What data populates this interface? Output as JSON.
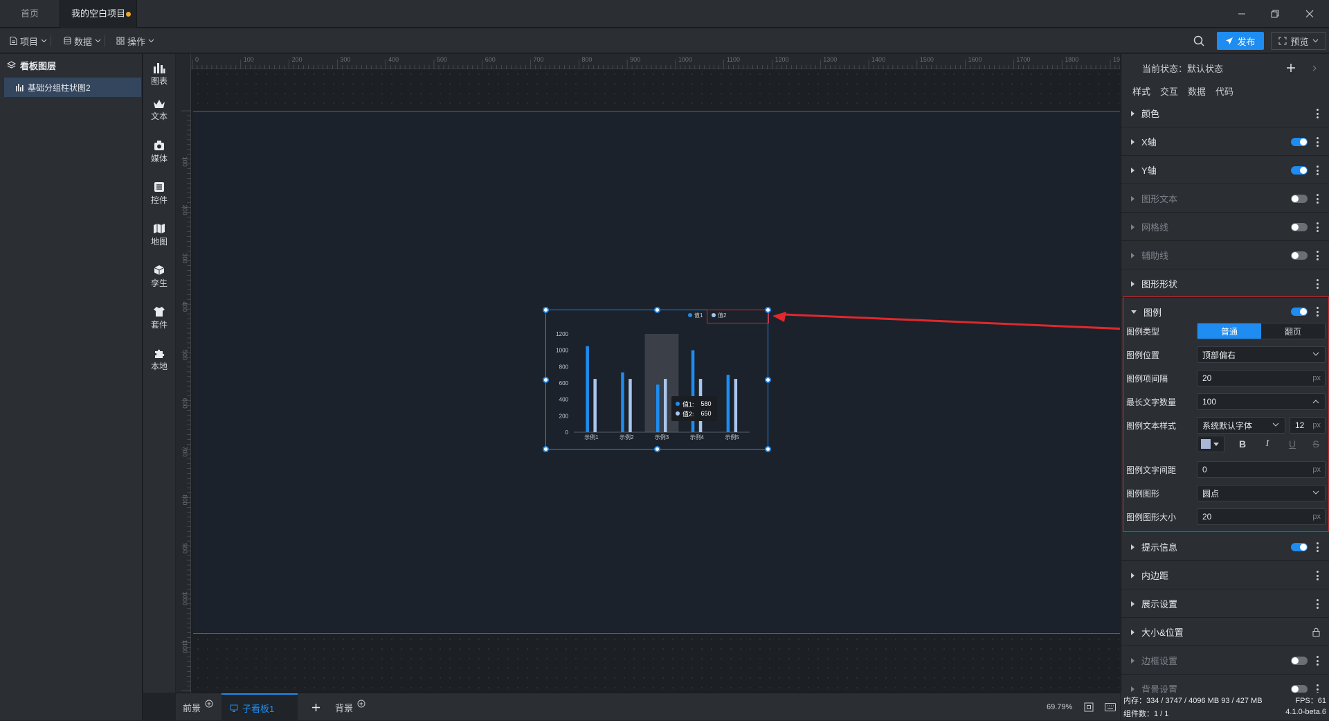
{
  "titlebar": {
    "tabs": [
      {
        "label": "首页"
      },
      {
        "label": "我的空白项目"
      }
    ]
  },
  "menubar": {
    "items": [
      {
        "label": "项目"
      },
      {
        "label": "数据"
      },
      {
        "label": "操作"
      }
    ],
    "publish_label": "发布",
    "preview_label": "预览",
    "accent": "#1e8cf0"
  },
  "layers": {
    "title": "看板图层",
    "items": [
      {
        "label": "基础分组柱状图2"
      }
    ]
  },
  "tools": [
    {
      "label": "图表",
      "icon": "bar-chart-icon"
    },
    {
      "label": "文本",
      "icon": "text-crown-icon"
    },
    {
      "label": "媒体",
      "icon": "media-icon"
    },
    {
      "label": "控件",
      "icon": "control-icon"
    },
    {
      "label": "地图",
      "icon": "map-icon"
    },
    {
      "label": "孪生",
      "icon": "cube-icon"
    },
    {
      "label": "套件",
      "icon": "kit-icon"
    },
    {
      "label": "本地",
      "icon": "puzzle-icon"
    }
  ],
  "ruler": {
    "h_labels": [
      "0",
      "100",
      "200",
      "300",
      "400",
      "500",
      "600",
      "700",
      "800",
      "900",
      "1000",
      "1100",
      "1200",
      "1300",
      "1400",
      "1500",
      "1600",
      "1700",
      "1800",
      "1900"
    ],
    "v_labels": [
      "100",
      "200",
      "300",
      "400",
      "500",
      "600",
      "700",
      "800",
      "900",
      "1000",
      "1100"
    ]
  },
  "chart_data": {
    "type": "bar",
    "categories": [
      "示例1",
      "示例2",
      "示例3",
      "示例4",
      "示例5"
    ],
    "series": [
      {
        "name": "值1",
        "values": [
          1050,
          730,
          580,
          1000,
          700
        ],
        "color": "#1e8cf0"
      },
      {
        "name": "值2",
        "values": [
          650,
          650,
          650,
          650,
          650
        ],
        "color": "#a9c6ee"
      }
    ],
    "yticks": [
      "0",
      "200",
      "400",
      "600",
      "800",
      "1000",
      "1200"
    ],
    "ylim": [
      0,
      1200
    ],
    "legend_position": "top-right",
    "highlighted_category": "示例3",
    "tooltip": {
      "rows": [
        {
          "label": "值1:",
          "value": "580"
        },
        {
          "label": "值2:",
          "value": "650"
        }
      ]
    }
  },
  "right_panel": {
    "state_label": "当前状态：默认状态",
    "tabs": [
      "样式",
      "交互",
      "数据",
      "代码"
    ],
    "sections_top": [
      {
        "label": "颜色",
        "toggle": null,
        "dim": false
      },
      {
        "label": "X轴",
        "toggle": "on",
        "dim": false
      },
      {
        "label": "Y轴",
        "toggle": "on",
        "dim": false
      },
      {
        "label": "图形文本",
        "toggle": "off",
        "dim": true
      },
      {
        "label": "网格线",
        "toggle": "off",
        "dim": true
      },
      {
        "label": "辅助线",
        "toggle": "off",
        "dim": true
      },
      {
        "label": "图形形状",
        "toggle": null,
        "dim": false
      }
    ],
    "legend": {
      "title": "图例",
      "type_label": "图例类型",
      "type_options": [
        "普通",
        "翻页"
      ],
      "position_label": "图例位置",
      "position_value": "顶部偏右",
      "gap_label": "图例项间隔",
      "gap_value": "20",
      "maxlen_label": "最长文字数量",
      "maxlen_value": "100",
      "textstyle_label": "图例文本样式",
      "font_value": "系统默认字体",
      "font_size": "12",
      "spacing_label": "图例文字间距",
      "spacing_value": "0",
      "shape_label": "图例图形",
      "shape_value": "圆点",
      "shape_size_label": "图例图形大小",
      "shape_size_value": "20",
      "unit": "px"
    },
    "sections_bottom": [
      {
        "label": "提示信息",
        "toggle": "on",
        "dim": false
      },
      {
        "label": "内边距",
        "toggle": null,
        "dim": false
      },
      {
        "label": "展示设置",
        "toggle": null,
        "dim": false
      },
      {
        "label": "大小&位置",
        "toggle": "lock",
        "dim": false
      },
      {
        "label": "边框设置",
        "toggle": "off",
        "dim": true
      },
      {
        "label": "背景设置",
        "toggle": "off",
        "dim": true
      }
    ]
  },
  "bottombar": {
    "front_label": "前景",
    "board_label": "子看板1",
    "background_label": "背景",
    "zoom": "69.79%"
  },
  "status": {
    "memory": "内存：334 / 3747 / 4096 MB  93 / 427 MB",
    "fps": "FPS：61",
    "components": "组件数：1 / 1",
    "version": "4.1.0-beta.6"
  }
}
